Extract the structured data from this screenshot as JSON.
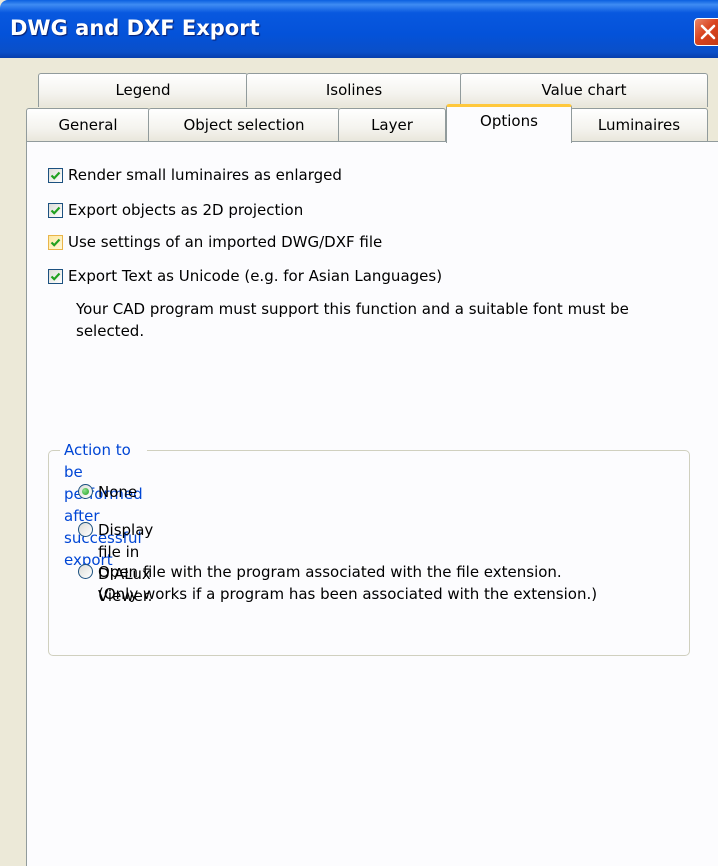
{
  "window": {
    "title": "DWG and DXF Export"
  },
  "tabs": {
    "row1": [
      "Legend",
      "Isolines",
      "Value chart"
    ],
    "row2": [
      "General",
      "Object selection",
      "Layer",
      "Options",
      "Luminaires"
    ],
    "active": "Options"
  },
  "options": {
    "checkboxes": [
      {
        "label": "Render small luminaires as enlarged",
        "checked": true
      },
      {
        "label": "Export objects as 2D projection",
        "checked": true
      },
      {
        "label": "Use settings of an imported DWG/DXF file",
        "checked": true
      },
      {
        "label": "Export Text as Unicode (e.g. for Asian Languages)",
        "checked": true
      }
    ],
    "unicode_note": "Your CAD program must support this function and a suitable font must be selected."
  },
  "post_export": {
    "group_title": "Action to be performed after successful export",
    "radios": [
      {
        "label": "None",
        "selected": true
      },
      {
        "label": "Display file in DIALux Viewer.",
        "selected": false
      },
      {
        "label": "Open file with the program associated with the file extension. (Only works if a program has been associated with the extension.)",
        "selected": false
      }
    ]
  },
  "colors": {
    "titlebar": "#0452d9",
    "active_tab_accent": "#ffc83c",
    "group_title": "#0046d5",
    "checkmark": "#21a121"
  }
}
